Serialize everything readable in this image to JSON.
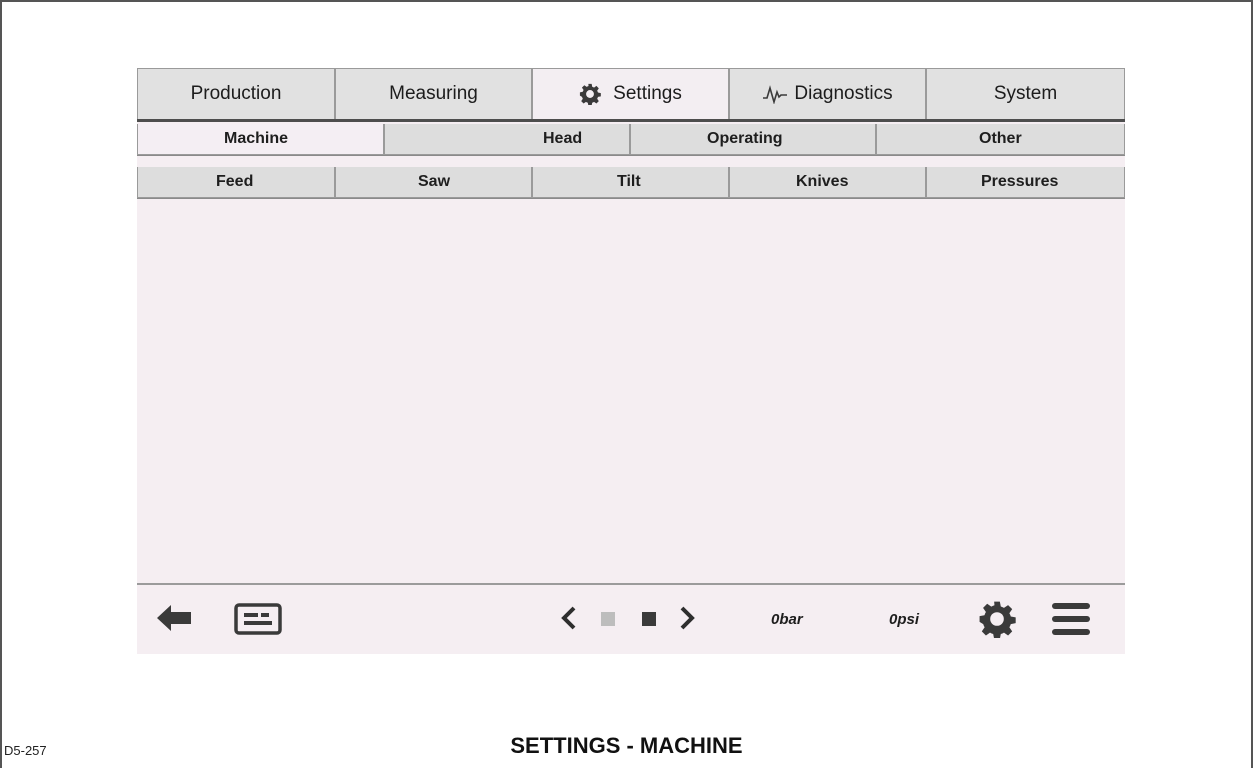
{
  "main_tabs": [
    {
      "label": "Production",
      "icon": null,
      "active": false
    },
    {
      "label": "Measuring",
      "icon": null,
      "active": false
    },
    {
      "label": "Settings",
      "icon": "gear-icon",
      "active": true
    },
    {
      "label": "Diagnostics",
      "icon": "pulse-icon",
      "active": false
    },
    {
      "label": "System",
      "icon": null,
      "active": false
    }
  ],
  "sub_tabs_row1": [
    {
      "label": "Machine",
      "active": true
    },
    {
      "label": "Head",
      "active": false
    },
    {
      "label": "Operating",
      "active": false
    },
    {
      "label": "Other",
      "active": false
    }
  ],
  "sub_tabs_row2": [
    {
      "label": "Feed",
      "active": false
    },
    {
      "label": "Saw",
      "active": false
    },
    {
      "label": "Tilt",
      "active": false
    },
    {
      "label": "Knives",
      "active": false
    },
    {
      "label": "Pressures",
      "active": false
    }
  ],
  "bottom_bar": {
    "back_icon": "arrow-left-icon",
    "keyboard_icon": "keyboard-icon",
    "prev_icon": "chevron-left-icon",
    "next_icon": "chevron-right-icon",
    "page_indicators": [
      {
        "state": "inactive"
      },
      {
        "state": "active"
      }
    ],
    "pressure_bar": "0bar",
    "pressure_psi": "0psi",
    "settings_icon": "gear-icon",
    "menu_icon": "hamburger-menu-icon"
  },
  "caption": {
    "id": "D5-257",
    "title": "SETTINGS - MACHINE"
  },
  "colors": {
    "screen_bg": "#f5eef2",
    "tab_bg": "#e1e1e1",
    "tab_border": "#9a9a9a",
    "icon_dark": "#3a3a3a"
  }
}
